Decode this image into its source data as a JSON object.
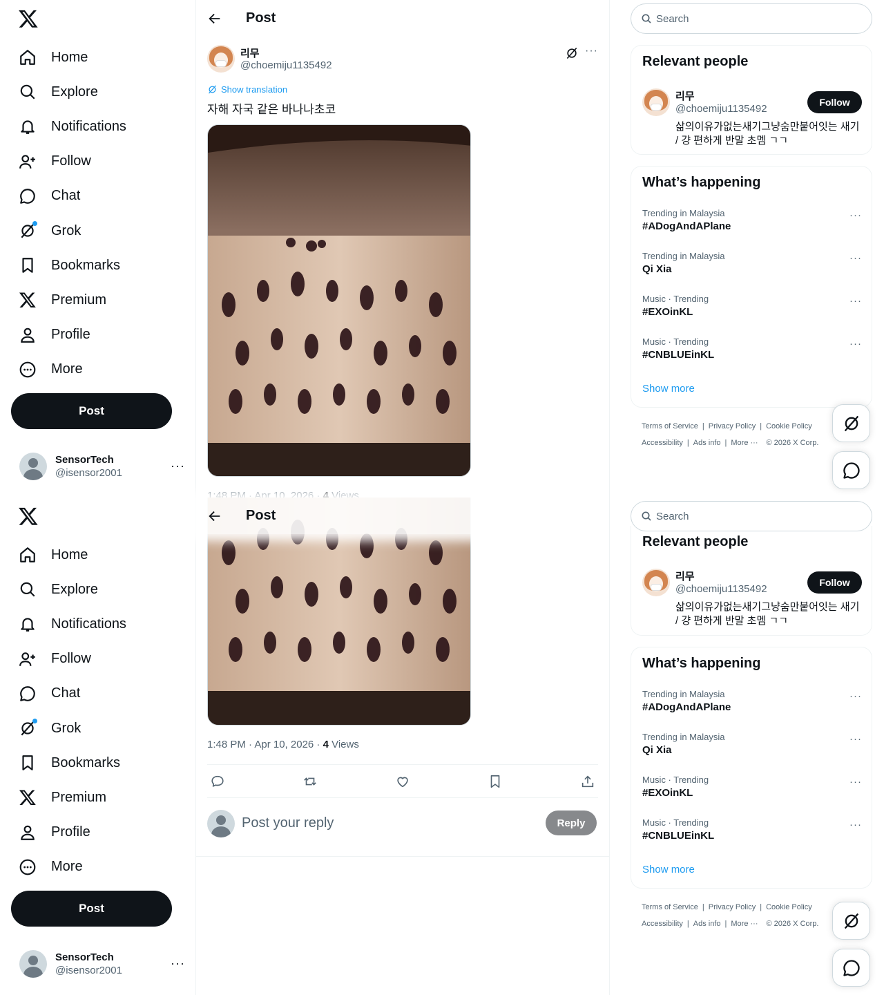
{
  "nav": {
    "items": [
      {
        "label": "Home",
        "icon": "home-icon"
      },
      {
        "label": "Explore",
        "icon": "search-icon"
      },
      {
        "label": "Notifications",
        "icon": "bell-icon"
      },
      {
        "label": "Follow",
        "icon": "person-add-icon"
      },
      {
        "label": "Chat",
        "icon": "chat-icon"
      },
      {
        "label": "Grok",
        "icon": "grok-icon"
      },
      {
        "label": "Bookmarks",
        "icon": "bookmark-icon"
      },
      {
        "label": "Premium",
        "icon": "x-logo-icon"
      },
      {
        "label": "Profile",
        "icon": "profile-icon"
      },
      {
        "label": "More",
        "icon": "more-circle-icon"
      }
    ],
    "post_label": "Post"
  },
  "account": {
    "name": "SensorTech",
    "handle": "@isensor2001",
    "more": "···"
  },
  "header": {
    "title": "Post"
  },
  "post": {
    "author_name": "리무",
    "author_handle": "@choemiju1135492",
    "more": "···",
    "show_translation": "Show translation",
    "text": "자해 자국 같은 바나나초코",
    "time": "1:48 PM · Apr 10, 2026 · ",
    "views_count": "4",
    "views_label": " Views"
  },
  "reply": {
    "placeholder": "Post your reply",
    "button": "Reply"
  },
  "search": {
    "placeholder": "Search"
  },
  "relevant": {
    "title": "Relevant people",
    "name": "리무",
    "handle": "@choemiju1135492",
    "bio": "삶의이유가없는새기그냥숨만붙어잇는 새기 / 걍 편하게 반말 초멤 ㄱㄱ",
    "follow": "Follow"
  },
  "happening": {
    "title": "What’s happening",
    "trends": [
      {
        "context": "Trending in Malaysia",
        "topic": "#ADogAndAPlane"
      },
      {
        "context": "Trending in Malaysia",
        "topic": "Qi Xia"
      },
      {
        "context": "Music · Trending",
        "topic": "#EXOinKL"
      },
      {
        "context": "Music · Trending",
        "topic": "#CNBLUEinKL"
      }
    ],
    "more_dots": "···",
    "show_more": "Show more"
  },
  "footer": {
    "terms": "Terms of Service",
    "privacy": "Privacy Policy",
    "cookie": "Cookie Policy",
    "accessibility": "Accessibility",
    "ads": "Ads info",
    "more": "More ···",
    "copyright": "© 2026 X Corp."
  },
  "colors": {
    "accent": "#1d9bf0",
    "text": "#0f1419",
    "muted": "#536471",
    "button": "#0f1419"
  }
}
